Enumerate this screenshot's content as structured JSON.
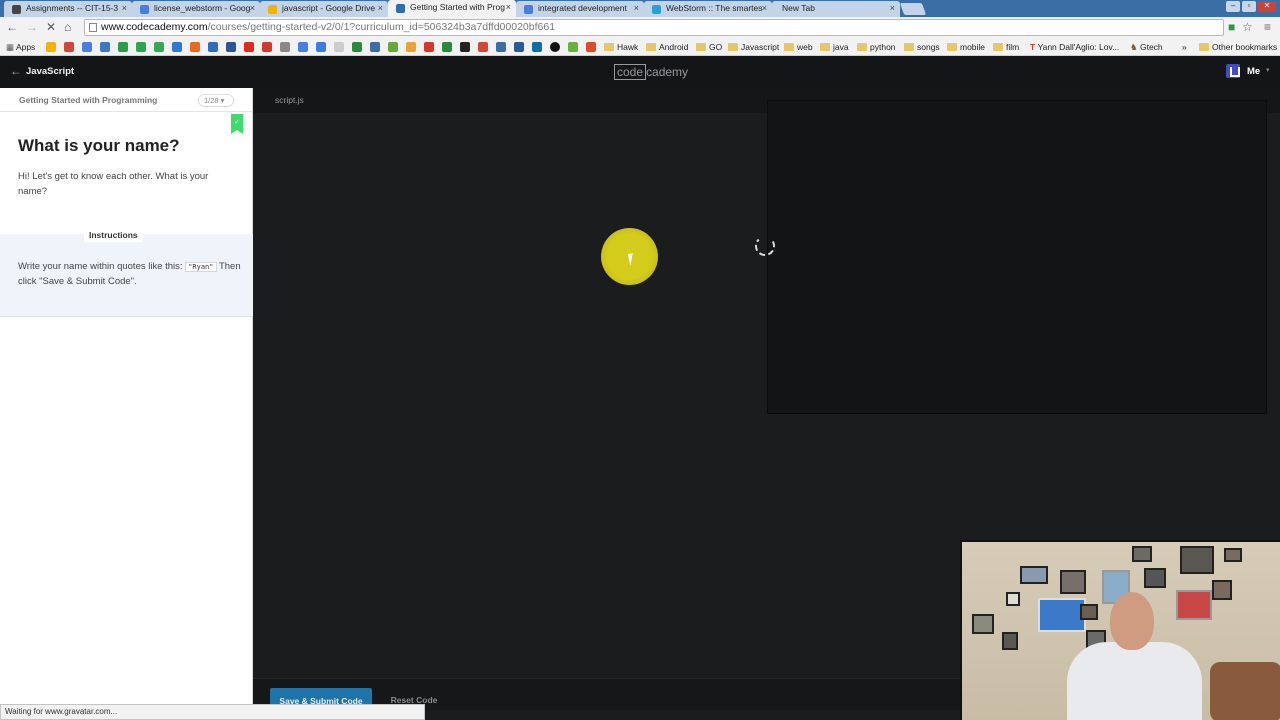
{
  "tabs": [
    {
      "label": "Assignments -- CIT-15-3",
      "color": "#444",
      "active": false
    },
    {
      "label": "license_webstorm - Goog",
      "color": "#4a7de0",
      "active": false
    },
    {
      "label": "javascript - Google Drive",
      "color": "#f2b400",
      "active": false
    },
    {
      "label": "Getting Started with Prog",
      "color": "#2c6fb0",
      "active": true
    },
    {
      "label": "integrated development",
      "color": "#4a7de0",
      "active": false
    },
    {
      "label": "WebStorm :: The smartes",
      "color": "#2aa0d8",
      "active": false
    },
    {
      "label": "New Tab",
      "color": "#c4d4e8",
      "active": false
    }
  ],
  "tab_close_glyph": "×",
  "window_controls": {
    "minimize": "–",
    "restore": "▫",
    "close": "✕"
  },
  "address": {
    "host": "www.codecademy.com",
    "path": "/courses/getting-started-v2/0/1?curriculum_id=506324b3a7dffd00020bf661"
  },
  "bookmarks": {
    "apps_label": "Apps",
    "folders": [
      "Hawk",
      "Android",
      "GO",
      "Javascript",
      "web",
      "java",
      "python",
      "songs",
      "mobile",
      "film"
    ],
    "yann": "Yann Dall'Aglio: Lov...",
    "gtech": "Gtech",
    "overflow": "»",
    "other": "Other bookmarks"
  },
  "header": {
    "back_glyph": "←",
    "course": "JavaScript",
    "logo_boxed": "code",
    "logo_rest": "cademy",
    "user": "Me",
    "caret": "▾"
  },
  "lesson": {
    "course_title": "Getting Started with Programming",
    "progress": "1/28 ▾",
    "check_glyph": "✓",
    "title": "What is your name?",
    "text": "Hi! Let's get to know each other. What is your name?",
    "instructions_label": "Instructions",
    "instr_before": "Write your name within quotes like this: ",
    "instr_code": "\"Ryan\"",
    "instr_after": " Then click \"Save & Submit Code\"."
  },
  "editor": {
    "file_tab": "script.js",
    "submit_label": "Save & Submit Code",
    "reset_label": "Reset Code"
  },
  "status": "Waiting for www.gravatar.com...",
  "colors": {
    "accent": "#1e73a8",
    "bookmark_flag": "#3ddc6c",
    "cursor_highlight": "#e8e01a"
  }
}
